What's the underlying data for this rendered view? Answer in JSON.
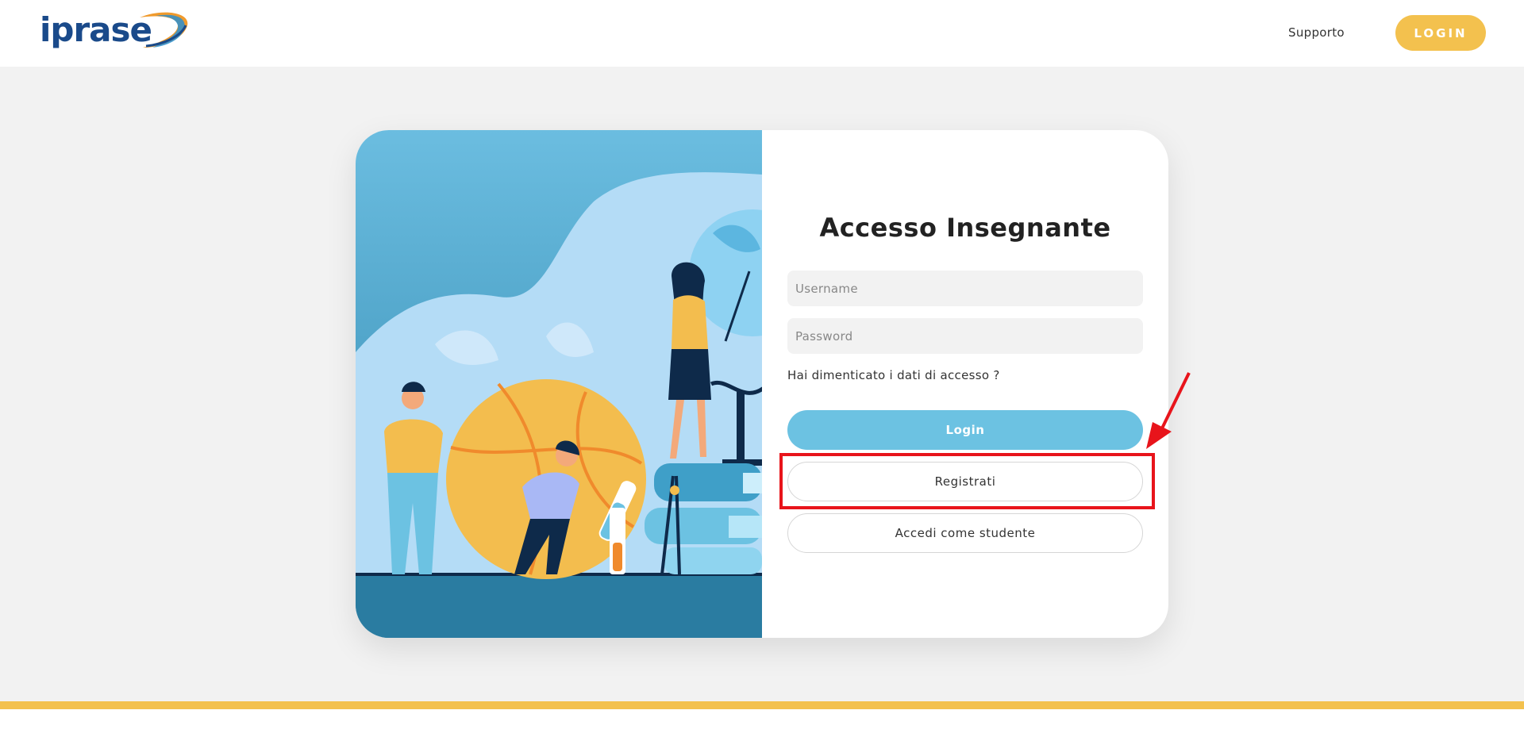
{
  "header": {
    "logo_text": "iprase",
    "nav_support": "Supporto",
    "login_button": "LOGIN"
  },
  "login_form": {
    "title": "Accesso Insegnante",
    "username_placeholder": "Username",
    "password_placeholder": "Password",
    "forgot_link": "Hai dimenticato i dati di accesso ?",
    "login_button": "Login",
    "register_button": "Registrati",
    "student_button": "Accedi come studente"
  },
  "colors": {
    "brand_yellow": "#f3c14e",
    "login_blue": "#6cc2e2",
    "annotation_red": "#e8141b",
    "logo_blue": "#1a4a8a"
  }
}
